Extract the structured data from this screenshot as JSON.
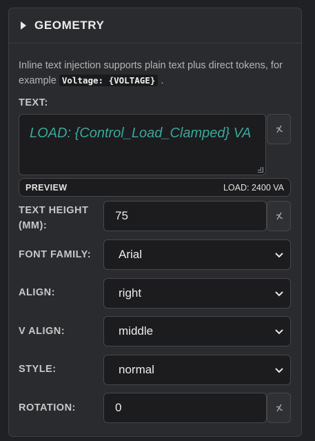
{
  "panel": {
    "title": "GEOMETRY",
    "note_prefix": "Inline text injection supports plain text plus direct tokens, for example",
    "note_code": "Voltage: {VOLTAGE}",
    "note_suffix": "."
  },
  "text_field": {
    "label": "TEXT:",
    "value": "LOAD: {Control_Load_Clamped} VA"
  },
  "preview": {
    "label": "PREVIEW",
    "value": "LOAD: 2400 VA"
  },
  "text_height": {
    "label_line1": "TEXT HEIGHT",
    "label_line2": "(MM):",
    "value": "75"
  },
  "font_family": {
    "label": "FONT FAMILY:",
    "value": "Arial"
  },
  "align": {
    "label": "ALIGN:",
    "value": "right"
  },
  "v_align": {
    "label": "V ALIGN:",
    "value": "middle"
  },
  "style": {
    "label": "STYLE:",
    "value": "normal"
  },
  "rotation": {
    "label": "ROTATION:",
    "value": "0"
  },
  "icons": {
    "link": "link-icon",
    "caret": "caret-right-icon",
    "chevron": "chevron-down-icon"
  },
  "colors": {
    "text_value": "#3aa79a",
    "panel_bg": "#2a2b2e",
    "page_bg": "#202124"
  }
}
